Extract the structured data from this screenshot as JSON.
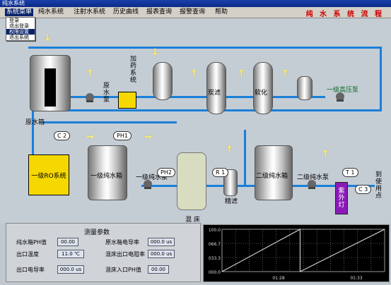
{
  "window": {
    "title": "纯水系统"
  },
  "menu": {
    "items": [
      "系统菜单",
      "纯水系统",
      "注射水系统",
      "历史曲线",
      "报表查询",
      "报警查询",
      "帮助"
    ],
    "app_title": "纯 水 系 统 流 程",
    "dropdown": [
      "登录",
      "退出登录",
      "权限设置",
      "退出系统"
    ]
  },
  "process": {
    "raw_tank": "原水箱",
    "raw_pump": "原水泵",
    "dosing": "加药系统",
    "carbon": "炭滤",
    "softener": "软化",
    "high_pump": "一级高压泵",
    "ro": "一级RO系统",
    "tank1": "一级纯水箱",
    "pump1": "一级纯水泵",
    "mix_bed": "混 床",
    "filter": "精滤",
    "tank2": "二级纯水箱",
    "pump2": "二级纯水泵",
    "uv": "紫外灯",
    "outlet": "到使用点",
    "tags": {
      "c2": "C 2",
      "ph1": "PH1",
      "ph2": "PH2",
      "r1": "R 1",
      "t1": "T 1",
      "c3": "C 3"
    }
  },
  "measure": {
    "title": "测量参数",
    "tank1_ph": {
      "label": "纯水箱PH值",
      "value": "00.00"
    },
    "outlet_temp": {
      "label": "出口温度",
      "value": "11.0",
      "unit": "℃"
    },
    "outlet_cond": {
      "label": "出口电导率",
      "value": "000.0",
      "unit": "us"
    },
    "raw_cond": {
      "label": "原水箱电导率",
      "value": "000.0",
      "unit": "us"
    },
    "mixbed_out_res": {
      "label": "混床出口电阻率",
      "value": "000.0",
      "unit": "us"
    },
    "mixbed_in_ph": {
      "label": "混床入口PH值",
      "value": "00.00"
    }
  },
  "trend": {
    "y_ticks": [
      "100.0",
      "066.7",
      "033.3",
      "000.0"
    ],
    "x_ticks": [
      "01:28",
      "01:33"
    ],
    "series": [
      {
        "x": [
          0.0,
          0.48,
          0.48,
          1.0
        ],
        "y": [
          0,
          100,
          0,
          100
        ]
      }
    ],
    "colors": {
      "grid": "#9a9a9a",
      "line": "#e8e8e8"
    }
  },
  "colors": {
    "pipe": "#1a7fd8",
    "ro": "#f5d800",
    "uv": "#8a1ab8",
    "title": "#d00000"
  }
}
